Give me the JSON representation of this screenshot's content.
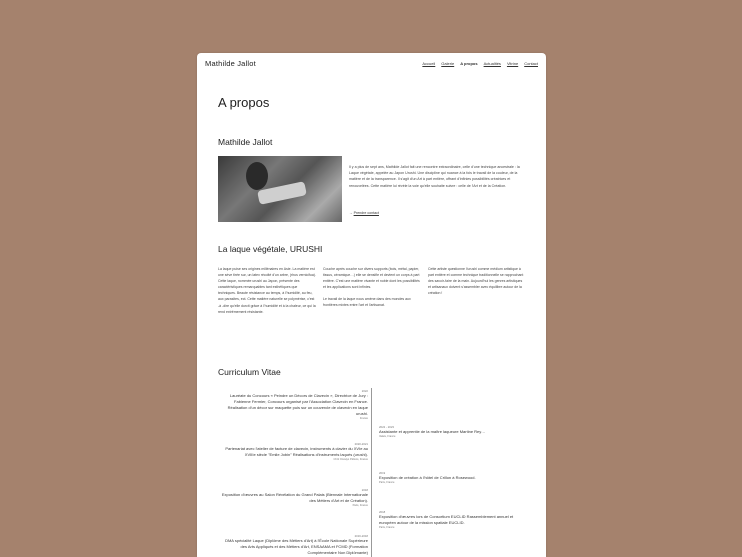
{
  "header": {
    "brand": "Mathilde Jallot",
    "nav": [
      "Accueil",
      "Galerie",
      "A propos",
      "Actualités",
      "Vitrine",
      "Contact"
    ]
  },
  "page_title": "A propos",
  "about": {
    "heading": "Mathilde Jallot",
    "text": "Il y a plus de sept ans, Mathilde Jallot fait une rencontre extraordinaire, celle d'une technique ancestrale : la Laque végétale, appelée au Japon Urushi. Une discipline qui nuance à la fois le travail de la couleur, de la matière et de la transparence. Il s'agit d'un Art à part entière, offrant d'infinies possibilités créatrices et renouvelées. Cette matière lui révèle la voie qu'elle souhaite suivre : celle de l'Art et de la Création.",
    "link_arrow": "→",
    "link": "Prendre contact"
  },
  "urushi": {
    "heading": "La laque végétale, URUSHI",
    "col1": "La laque puise ses origines millénaires en Asie. La matière est une sève tirée sur, un latex récolté d'un arbre, (rhus vernicifua). Cette laque, nommée urushi au Japon, présente des caractéristiques remarquables tant esthétiques que techniques. Beaute résistance au temps, à l'humidité, au feu, aux parasites, ect. Cette matière naturelle se polymérise, c'est -à -dire qu'elle durcit grâce à l'humidité et à la chaleur, ce qui la rend extrêmement résistante.",
    "col2a": "Couche après couche sur divers supports (bois, métal, papier, tissus, céramique…) elle se densifie et devient un corps à part entière. C'est une matière vivante et noble dont les possibilités et les applications sont infinies.",
    "col2b": "Le travail de la laque nous amène dans des mondes aux frontières mixtes entre l'art et l'artisanat.",
    "col3": "Cette artiste questionne l'urushi comme médium artistique à part entière et comme technique traditionnelle se rapprochant des savoir-faire de la main. Aujourd'hui les genres artistiques et artisanaux doivent s'assembler avec équilibre autour de la création !"
  },
  "cv": {
    "heading": "Curriculum Vitae",
    "left": [
      {
        "date": "2022",
        "title": "Lauréate du Concours « Peindre un Décors de Clavecin », Directrice de Jury : Fabienne Fermier, Concours organisé par l'Association Clavecin en France. Réalisation d'un décor sur maquette puis sur un couvercle de clavecin en laque urushi.",
        "place": "France"
      },
      {
        "date": "2020-2021",
        "title": "Partenariat avec l'atelier de facture de clavecin, instruments à clavier du XVIe au XVIIIe siècle \"Emile Jobin\" Réalisations d'instruments laqués (urushi).",
        "place": "Chrit Onésiyo Pélions, France"
      },
      {
        "date": "2018",
        "title": "Exposition d'œuvres au Salon Révélation du Grand Palais (Biennale Internationale des Métiers d'Art et de Création).",
        "place": "Paris, France"
      },
      {
        "date": "2016-2018",
        "title": "DMA spécialité Laque (Diplôme des Métiers d'Art) à l'École Nationale Supérieure des Arts Appliqués et des Métiers d'Art, ENSAAMA et FCMD (Formation Complémentaire Non Diplômante)",
        "place": ""
      }
    ],
    "right": [
      {
        "date": "2022 - 2023",
        "title": "Assistante et apprentie de la maître laqueure Martine Rey…",
        "place": "Valais, France"
      },
      {
        "date": "2019",
        "title": "Exposition de création à l'hôtel de Crillon à Rosewood.",
        "place": "Paris, France"
      },
      {
        "date": "2018",
        "title": "Exposition d'œuvres lors de Consortium EUCLID Rassemblement annuel et européen autour de la mission spatiale EUCLID.",
        "place": "Paris, France"
      }
    ]
  }
}
